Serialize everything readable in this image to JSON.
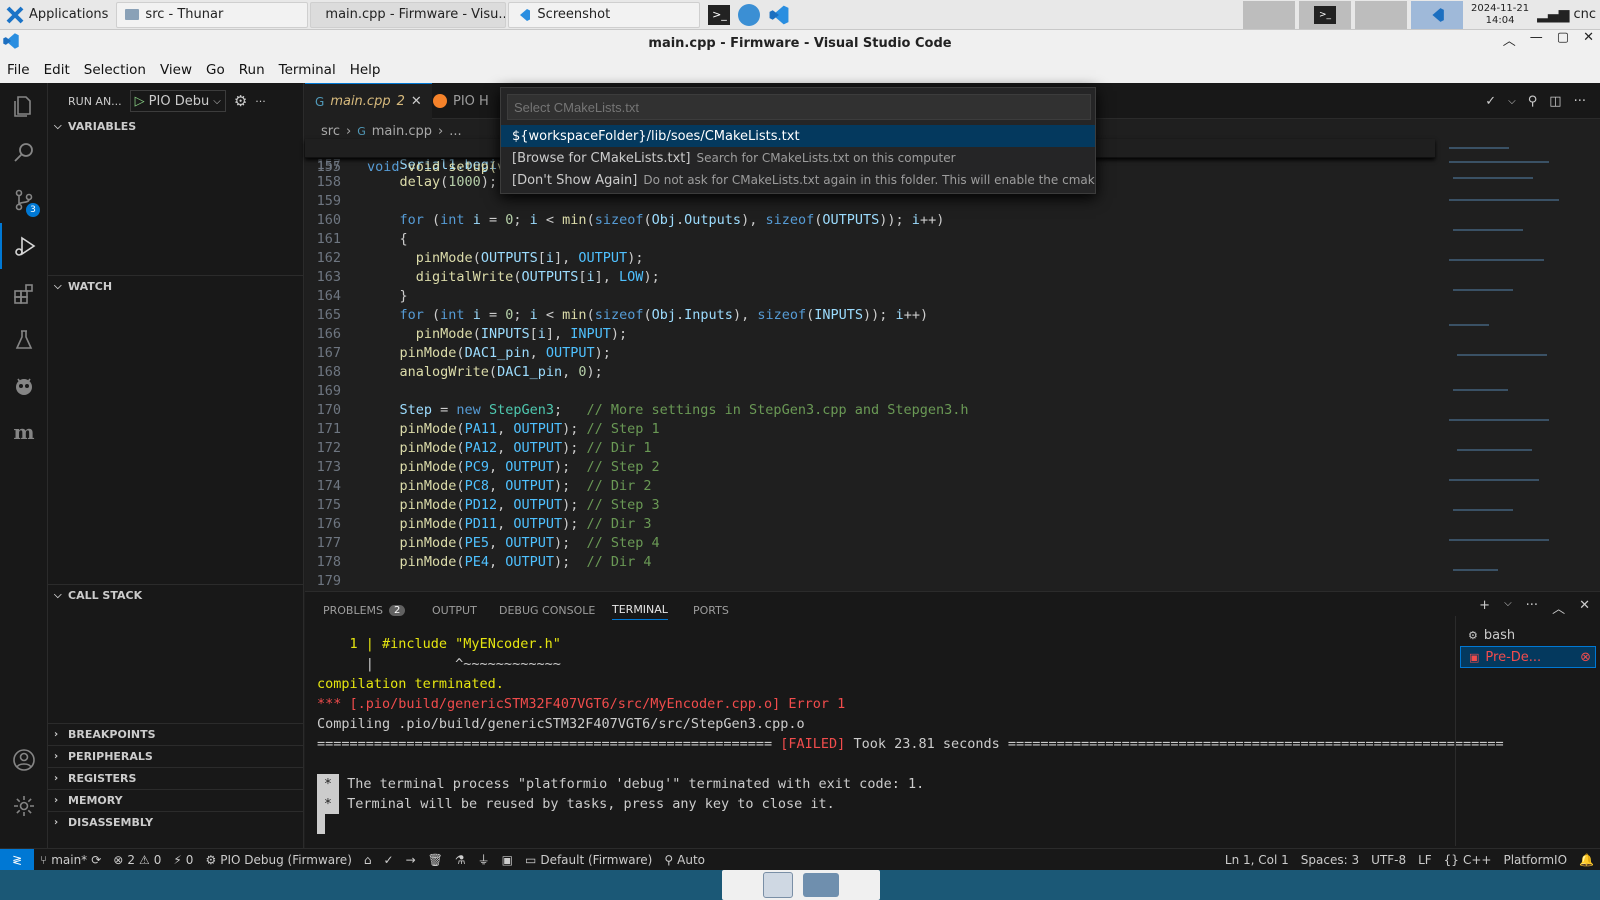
{
  "taskbar": {
    "applications_label": "Applications",
    "tasks": [
      "src - Thunar",
      "main.cpp - Firmware - Visu...",
      "Screenshot"
    ],
    "clock_date": "2024-11-21",
    "clock_time": "14:04",
    "user": "cnc"
  },
  "window": {
    "title": "main.cpp - Firmware - Visual Studio Code"
  },
  "menu": [
    "File",
    "Edit",
    "Selection",
    "View",
    "Go",
    "Run",
    "Terminal",
    "Help"
  ],
  "sidebar": {
    "header": "RUN AN...",
    "config": "PIO Debu",
    "sections": {
      "variables": "VARIABLES",
      "watch": "WATCH",
      "call_stack": "CALL STACK",
      "breakpoints": "BREAKPOINTS",
      "peripherals": "PERIPHERALS",
      "registers": "REGISTERS",
      "memory": "MEMORY",
      "disassembly": "DISASSEMBLY"
    },
    "scm_badge": "3"
  },
  "tabs": {
    "active_name": "main.cpp",
    "active_modified_count": "2",
    "second": "PIO H"
  },
  "breadcrumb": {
    "folder": "src",
    "file": "main.cpp",
    "more": "..."
  },
  "code": {
    "sticky_line": "155",
    "sticky_text": "void setup(void",
    "partial_line": "157",
    "partial_text": "Serial1.begi",
    "lines": [
      {
        "n": "158"
      },
      {
        "n": "159"
      },
      {
        "n": "160"
      },
      {
        "n": "161"
      },
      {
        "n": "162"
      },
      {
        "n": "163"
      },
      {
        "n": "164"
      },
      {
        "n": "165"
      },
      {
        "n": "166"
      },
      {
        "n": "167"
      },
      {
        "n": "168"
      },
      {
        "n": "169"
      },
      {
        "n": "170"
      },
      {
        "n": "171"
      },
      {
        "n": "172"
      },
      {
        "n": "173"
      },
      {
        "n": "174"
      },
      {
        "n": "175"
      },
      {
        "n": "176"
      },
      {
        "n": "177"
      },
      {
        "n": "178"
      },
      {
        "n": "179"
      }
    ]
  },
  "quickpick": {
    "placeholder": "Select CMakeLists.txt",
    "items": [
      {
        "label": "${workspaceFolder}/lib/soes/CMakeLists.txt",
        "desc": ""
      },
      {
        "label": "[Browse for CMakeLists.txt]",
        "desc": "Search for CMakeLists.txt on this computer"
      },
      {
        "label": "[Don't Show Again]",
        "desc": "Do not ask for CMakeLists.txt again in this folder. This will enable the cmake.ig..."
      }
    ]
  },
  "panel": {
    "tabs": [
      "PROBLEMS",
      "OUTPUT",
      "DEBUG CONSOLE",
      "TERMINAL",
      "PORTS"
    ],
    "problems_count": "2",
    "terminal_lines": {
      "l1_prefix": "    1 | ",
      "l1_code": "#include \"MyENcoder.h\"",
      "l2": "      |          ^~~~~~~~~~~~~",
      "l3": "compilation terminated.",
      "l4": "*** [.pio/build/genericSTM32F407VGT6/src/MyEncoder.cpp.o] Error 1",
      "l5": "Compiling .pio/build/genericSTM32F407VGT6/src/StepGen3.cpp.o",
      "l6_left": "======================================================== ",
      "l6_failed": "[FAILED]",
      "l6_right": " Took 23.81 seconds =============================================================",
      "l7": "The terminal process \"platformio 'debug'\" terminated with exit code: 1.",
      "l8": "Terminal will be reused by tasks, press any key to close it."
    },
    "terminals": [
      "bash",
      "Pre-De..."
    ]
  },
  "status": {
    "branch": "main*",
    "errors": "2",
    "warnings": "0",
    "ports": "0",
    "debug": "PIO Debug (Firmware)",
    "env": "Default (Firmware)",
    "auto": "Auto",
    "position": "Ln 1, Col 1",
    "spaces": "Spaces: 3",
    "encoding": "UTF-8",
    "eol": "LF",
    "language": "C++",
    "platform": "PlatformIO"
  },
  "colors": {
    "accent": "#0078d4",
    "error": "#f14c4c",
    "warn_yellow": "#e5e510"
  }
}
